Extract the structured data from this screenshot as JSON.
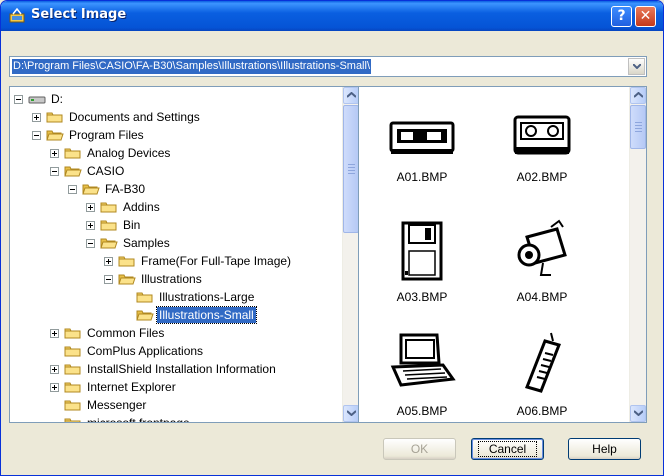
{
  "window": {
    "title": "Select Image"
  },
  "path": {
    "value": "D:\\Program Files\\CASIO\\FA-B30\\Samples\\Illustrations\\Illustrations-Small\\"
  },
  "tree": {
    "items": [
      {
        "label": "D:",
        "icon": "drive-icon",
        "expander": "minus"
      },
      {
        "label": "Documents and Settings",
        "icon": "folder-icon",
        "expander": "plus"
      },
      {
        "label": "Program Files",
        "icon": "folder-open-icon",
        "expander": "minus"
      },
      {
        "label": "Analog Devices",
        "icon": "folder-icon",
        "expander": "plus"
      },
      {
        "label": "CASIO",
        "icon": "folder-open-icon",
        "expander": "minus"
      },
      {
        "label": "FA-B30",
        "icon": "folder-open-icon",
        "expander": "minus"
      },
      {
        "label": "Addins",
        "icon": "folder-icon",
        "expander": "plus"
      },
      {
        "label": "Bin",
        "icon": "folder-icon",
        "expander": "plus"
      },
      {
        "label": "Samples",
        "icon": "folder-open-icon",
        "expander": "minus"
      },
      {
        "label": "Frame(For Full-Tape Image)",
        "icon": "folder-icon",
        "expander": "plus"
      },
      {
        "label": "Illustrations",
        "icon": "folder-open-icon",
        "expander": "minus"
      },
      {
        "label": "Illustrations-Large",
        "icon": "folder-icon",
        "expander": "none"
      },
      {
        "label": "Illustrations-Small",
        "icon": "folder-open-icon",
        "expander": "none",
        "selected": true
      },
      {
        "label": "Common Files",
        "icon": "folder-icon",
        "expander": "plus"
      },
      {
        "label": "ComPlus Applications",
        "icon": "folder-icon",
        "expander": "none"
      },
      {
        "label": "InstallShield Installation Information",
        "icon": "folder-icon",
        "expander": "plus"
      },
      {
        "label": "Internet Explorer",
        "icon": "folder-icon",
        "expander": "plus"
      },
      {
        "label": "Messenger",
        "icon": "folder-icon",
        "expander": "none"
      },
      {
        "label": "microsoft frontpage",
        "icon": "folder-icon",
        "expander": "none"
      }
    ]
  },
  "images": [
    {
      "name": "A01.BMP",
      "icon": "vhs-tape-icon"
    },
    {
      "name": "A02.BMP",
      "icon": "cassette-tape-icon"
    },
    {
      "name": "A03.BMP",
      "icon": "floppy-disk-icon"
    },
    {
      "name": "A04.BMP",
      "icon": "camcorder-icon"
    },
    {
      "name": "A05.BMP",
      "icon": "laptop-icon"
    },
    {
      "name": "A06.BMP",
      "icon": "cordless-phone-icon"
    }
  ],
  "buttons": {
    "ok": "OK",
    "cancel": "Cancel",
    "help": "Help"
  },
  "colors": {
    "titlebar": "#0a5fe0",
    "selection": "#316ac5",
    "face": "#ece9d8"
  }
}
